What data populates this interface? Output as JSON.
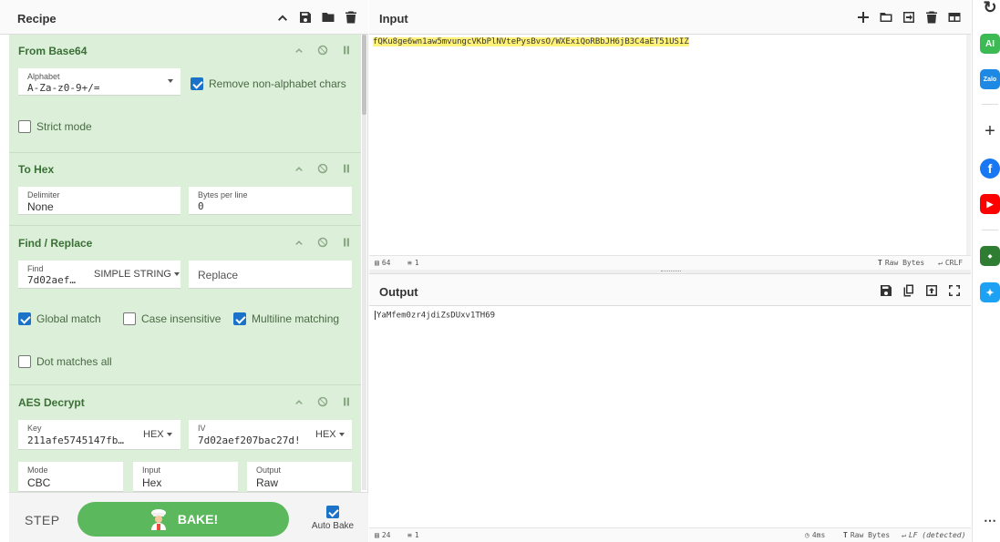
{
  "recipe": {
    "title": "Recipe",
    "operations": [
      {
        "name": "From Base64",
        "alphabet_label": "Alphabet",
        "alphabet_value": "A-Za-z0-9+/=",
        "remove_non_alpha_label": "Remove non-alphabet chars",
        "remove_non_alpha_checked": true,
        "strict_mode_label": "Strict mode",
        "strict_mode_checked": false
      },
      {
        "name": "To Hex",
        "delimiter_label": "Delimiter",
        "delimiter_value": "None",
        "bytes_per_line_label": "Bytes per line",
        "bytes_per_line_value": "0"
      },
      {
        "name": "Find / Replace",
        "find_label": "Find",
        "find_value": "7d02aef…",
        "find_type": "SIMPLE STRING",
        "replace_placeholder": "Replace",
        "global_match_label": "Global match",
        "global_match_checked": true,
        "case_insensitive_label": "Case insensitive",
        "case_insensitive_checked": false,
        "multiline_label": "Multiline matching",
        "multiline_checked": true,
        "dot_matches_all_label": "Dot matches all",
        "dot_matches_all_checked": false
      },
      {
        "name": "AES Decrypt",
        "key_label": "Key",
        "key_value": "211afe5745147fb…",
        "key_type": "HEX",
        "iv_label": "IV",
        "iv_value": "7d02aef207bac27d!",
        "iv_type": "HEX",
        "mode_label": "Mode",
        "mode_value": "CBC",
        "input_label": "Input",
        "input_value": "Hex",
        "output_label": "Output",
        "output_value": "Raw"
      }
    ]
  },
  "controls": {
    "step_label": "STEP",
    "bake_label": "BAKE!",
    "auto_bake_label": "Auto Bake",
    "auto_bake_checked": true
  },
  "input": {
    "title": "Input",
    "text": "fQKu8ge6wn1aw5mvungcVKbPlNVtePysBvsO/WXExiQoRBbJH6jB3C4aET51USIZ",
    "status_length": "64",
    "status_lines": "1",
    "status_encoding": "Raw Bytes",
    "status_eol": "CRLF"
  },
  "output": {
    "title": "Output",
    "text": "YaMfem0zr4jdiZsDUxv1TH69",
    "status_length": "24",
    "status_lines": "1",
    "status_time": "4ms",
    "status_encoding": "Raw Bytes",
    "status_eol": "LF (detected)"
  },
  "browser_sidebar": {
    "ai_label": "AI",
    "zalo_label": "Zalo"
  },
  "colors": {
    "operation_bg": "#dcefd8",
    "operation_title": "#3a6f36",
    "bake_button": "#5cb85c",
    "checkbox_checked": "#1a73c8",
    "input_highlight": "#fff27a"
  }
}
